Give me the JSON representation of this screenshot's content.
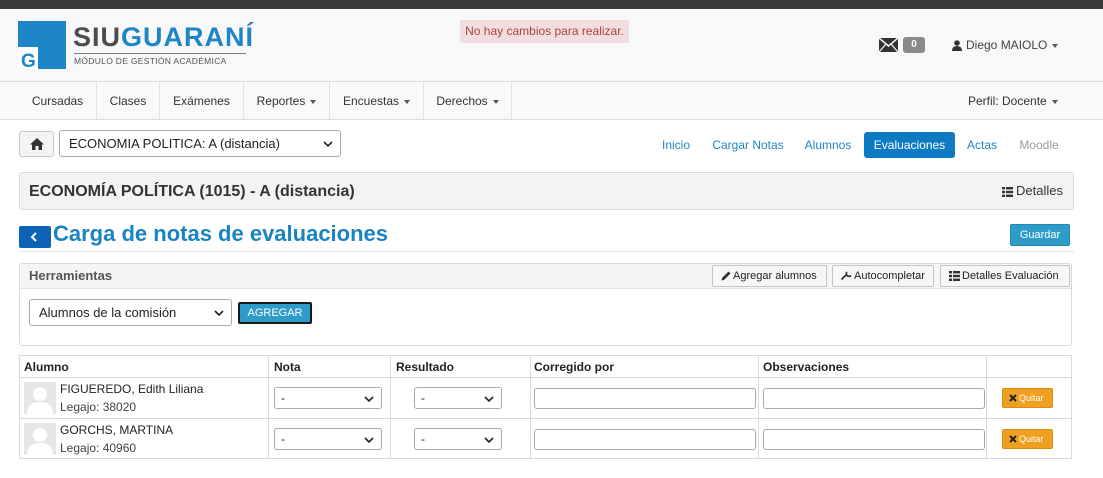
{
  "brand": {
    "title_siu": "SIU",
    "title_guarani": "GUARANÍ",
    "subtitle": "MÓDULO DE GESTIÓN ACADÉMICA",
    "primary_color": "#1e86c8"
  },
  "flash_message": "No hay cambios para realizar.",
  "messages": {
    "count": "0",
    "icon": "envelope-icon"
  },
  "user": {
    "name": "Diego MAIOLO"
  },
  "nav": {
    "items": [
      {
        "label": "Cursadas",
        "dropdown": false
      },
      {
        "label": "Clases",
        "dropdown": false
      },
      {
        "label": "Exámenes",
        "dropdown": false
      },
      {
        "label": "Reportes",
        "dropdown": true
      },
      {
        "label": "Encuestas",
        "dropdown": true
      },
      {
        "label": "Derechos",
        "dropdown": true
      }
    ],
    "profile": "Perfil: Docente"
  },
  "course_selector": {
    "value": "ECONOMIA POLITICA: A (distancia)"
  },
  "tabs": [
    {
      "label": "Inicio",
      "state": "normal"
    },
    {
      "label": "Cargar Notas",
      "state": "normal"
    },
    {
      "label": "Alumnos",
      "state": "normal"
    },
    {
      "label": "Evaluaciones",
      "state": "active"
    },
    {
      "label": "Actas",
      "state": "normal"
    },
    {
      "label": "Moodle",
      "state": "muted"
    }
  ],
  "course_panel": {
    "title": "ECONOMÍA POLÍTICA (1015) - A (distancia)",
    "details_label": "Detalles"
  },
  "page": {
    "title": "Carga de notas de evaluaciones",
    "save_label": "Guardar"
  },
  "tools": {
    "title": "Herramientas",
    "buttons": [
      {
        "label": "Agregar alumnos",
        "icon": "pencil-icon"
      },
      {
        "label": "Autocompletar",
        "icon": "wrench-icon"
      },
      {
        "label": "Detalles Evaluación",
        "icon": "list-icon"
      }
    ],
    "select_value": "Alumnos de la comisión",
    "add_label": "AGREGAR"
  },
  "table": {
    "columns": [
      "Alumno",
      "Nota",
      "Resultado",
      "Corregido por",
      "Observaciones",
      ""
    ],
    "rows": [
      {
        "name": "FIGUEREDO, Edith Liliana",
        "legajo": "Legajo: 38020",
        "nota": "-",
        "resultado": "-",
        "corregido_por": "",
        "observaciones": "",
        "remove_label": "Quitar"
      },
      {
        "name": "GORCHS, MARTINA",
        "legajo": "Legajo: 40960",
        "nota": "-",
        "resultado": "-",
        "corregido_por": "",
        "observaciones": "",
        "remove_label": "Quitar"
      }
    ]
  }
}
